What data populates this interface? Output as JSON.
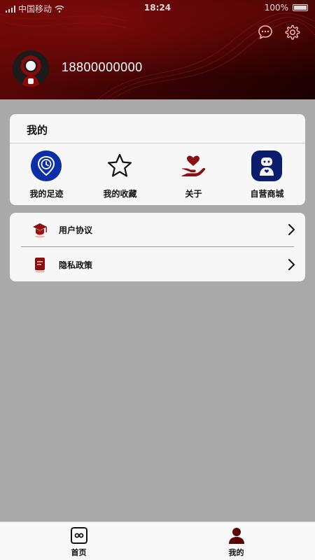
{
  "status_bar": {
    "carrier": "中国移动",
    "time": "18:24",
    "battery": "100%"
  },
  "profile": {
    "phone": "18800000000"
  },
  "mine_card": {
    "title": "我的",
    "items": [
      {
        "label": "我的足迹",
        "icon": "clock-location-icon"
      },
      {
        "label": "我的收藏",
        "icon": "star-icon"
      },
      {
        "label": "关于",
        "icon": "heart-hand-icon"
      },
      {
        "label": "自营商城",
        "icon": "robot-icon"
      }
    ]
  },
  "list": [
    {
      "label": "用户协议",
      "icon": "graduation-cap-icon"
    },
    {
      "label": "隐私政策",
      "icon": "document-icon"
    }
  ],
  "tabbar": {
    "tabs": [
      {
        "label": "首页",
        "icon": "home-icon"
      },
      {
        "label": "我的",
        "icon": "user-icon"
      }
    ]
  },
  "colors": {
    "brand_dark_red": "#3a0303",
    "accent_red": "#8b0f0f",
    "icon_blue": "#0b2fa8",
    "background_gray": "#a9a9a9",
    "card_bg": "#f7f7f7"
  }
}
